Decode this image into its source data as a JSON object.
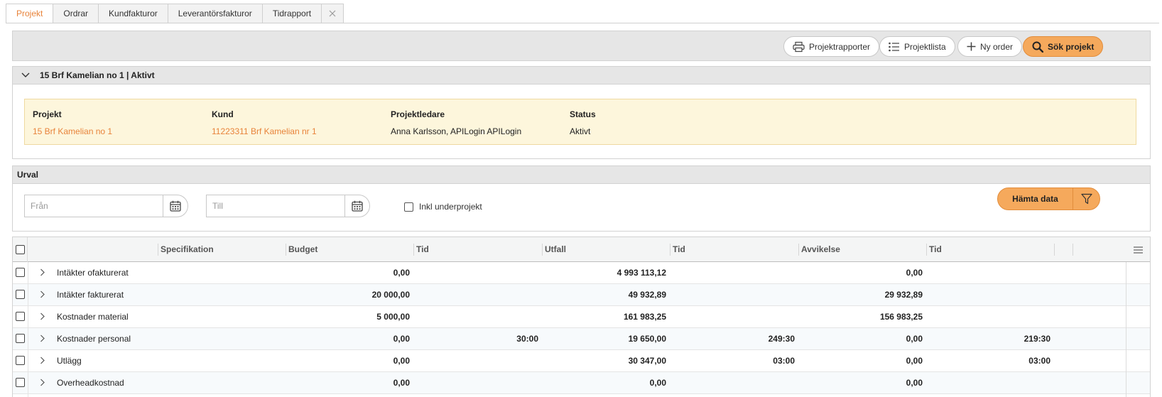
{
  "tabs": [
    {
      "label": "Projekt",
      "active": true
    },
    {
      "label": "Ordrar",
      "active": false
    },
    {
      "label": "Kundfakturor",
      "active": false
    },
    {
      "label": "Leverantörsfakturor",
      "active": false
    },
    {
      "label": "Tidrapport",
      "active": false
    }
  ],
  "toolbar": {
    "projektrapporter": "Projektrapporter",
    "projektlista": "Projektlista",
    "ny_order": "Ny order",
    "sok_projekt": "Sök projekt"
  },
  "project_panel": {
    "header": "15 Brf Kamelian no 1 | Aktivt",
    "projekt_label": "Projekt",
    "projekt_value": "15 Brf Kamelian no 1",
    "kund_label": "Kund",
    "kund_value": "11223311 Brf Kamelian nr 1",
    "projektledare_label": "Projektledare",
    "projektledare_value": "Anna Karlsson, APILogin APILogin",
    "status_label": "Status",
    "status_value": "Aktivt"
  },
  "urval": {
    "header": "Urval",
    "from_placeholder": "Från",
    "to_placeholder": "Till",
    "inkl_underprojekt": "Inkl underprojekt",
    "hamta_data": "Hämta data"
  },
  "grid": {
    "columns": [
      "Specifikation",
      "Budget",
      "Tid",
      "Utfall",
      "Tid",
      "Avvikelse",
      "Tid"
    ],
    "rows": [
      {
        "spec": "Intäkter ofakturerat",
        "budget": "0,00",
        "budget_tid": "",
        "utfall": "4 993 113,12",
        "utfall_tid": "",
        "avvikelse": "0,00",
        "avvikelse_tid": ""
      },
      {
        "spec": "Intäkter fakturerat",
        "budget": "20 000,00",
        "budget_tid": "",
        "utfall": "49 932,89",
        "utfall_tid": "",
        "avvikelse": "29 932,89",
        "avvikelse_tid": ""
      },
      {
        "spec": "Kostnader material",
        "budget": "5 000,00",
        "budget_tid": "",
        "utfall": "161 983,25",
        "utfall_tid": "",
        "avvikelse": "156 983,25",
        "avvikelse_tid": ""
      },
      {
        "spec": "Kostnader personal",
        "budget": "0,00",
        "budget_tid": "30:00",
        "utfall": "19 650,00",
        "utfall_tid": "249:30",
        "avvikelse": "0,00",
        "avvikelse_tid": "219:30"
      },
      {
        "spec": "Utlägg",
        "budget": "0,00",
        "budget_tid": "",
        "utfall": "30 347,00",
        "utfall_tid": "03:00",
        "avvikelse": "0,00",
        "avvikelse_tid": "03:00"
      },
      {
        "spec": "Overheadkostnad",
        "budget": "0,00",
        "budget_tid": "",
        "utfall": "0,00",
        "utfall_tid": "",
        "avvikelse": "0,00",
        "avvikelse_tid": ""
      }
    ]
  },
  "colors": {
    "accent": "#e8833a",
    "primary_button": "#f5a95c",
    "info_box": "#fdf6dc"
  }
}
